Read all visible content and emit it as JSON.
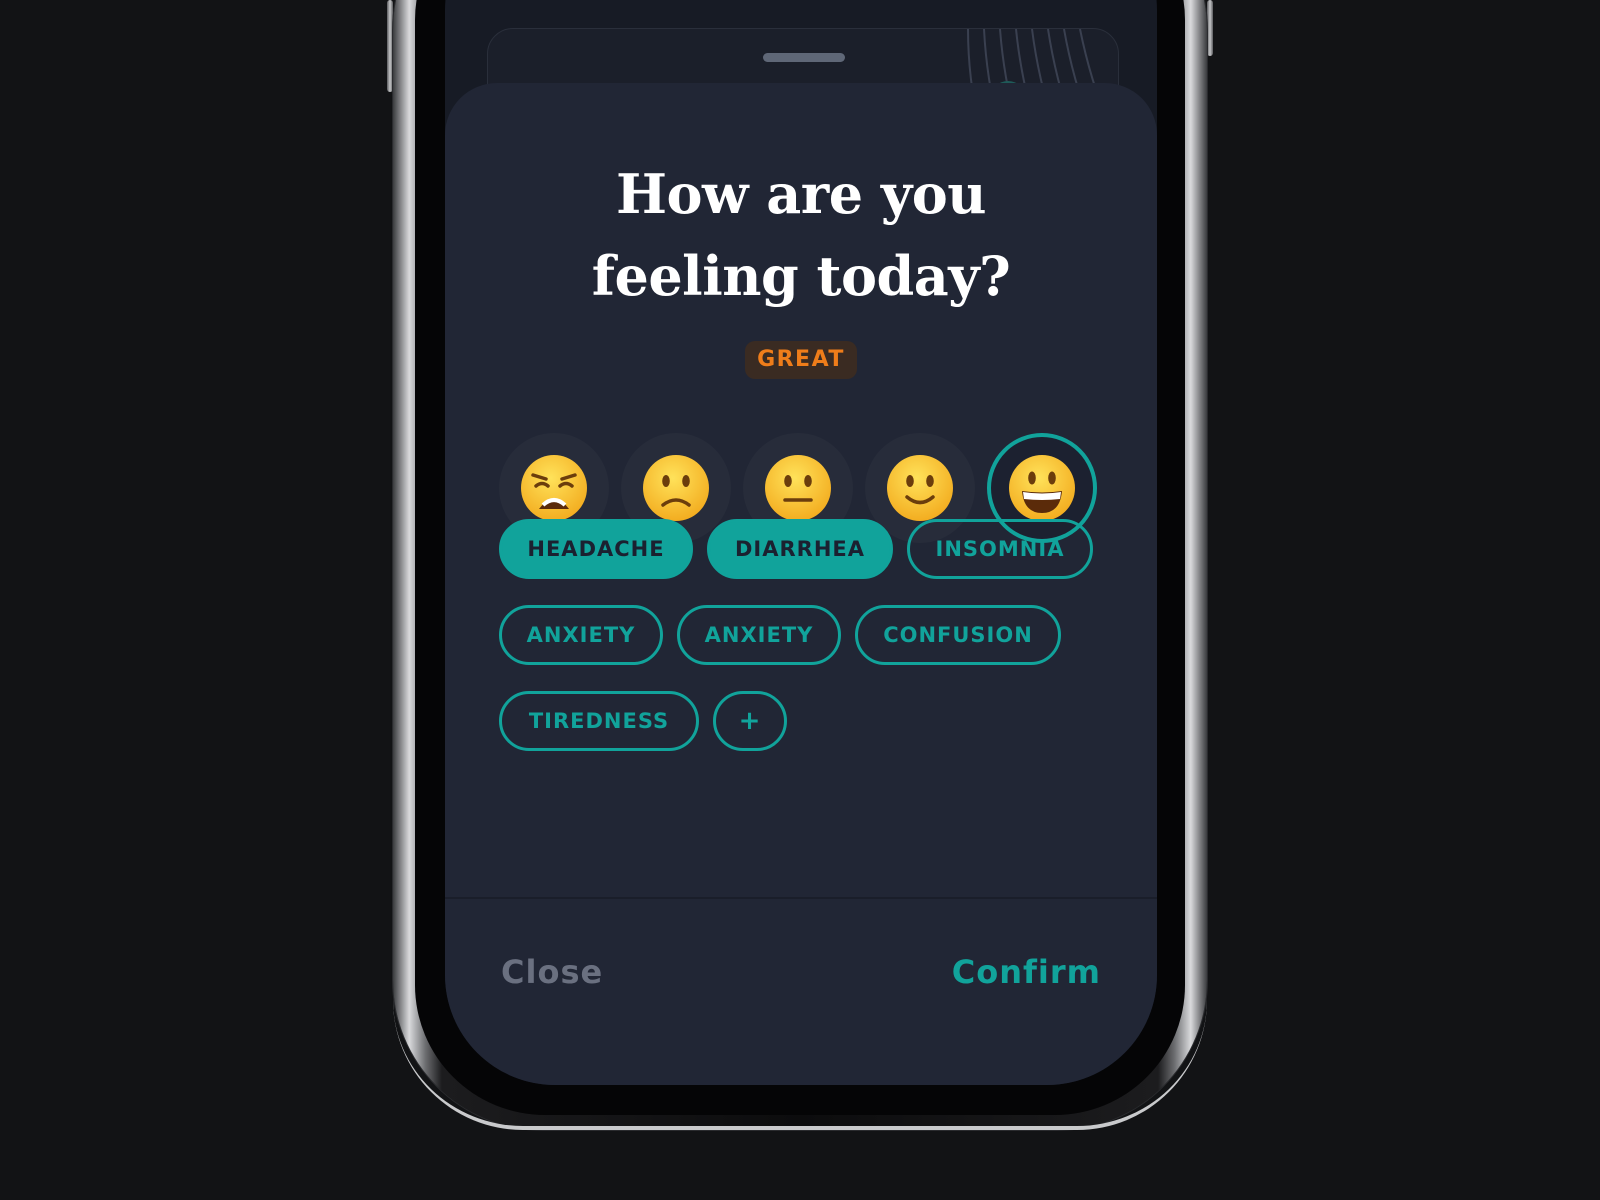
{
  "sheet": {
    "title_line1": "How are you",
    "title_line2": "feeling today?",
    "mood_label": "GREAT",
    "moods": [
      {
        "icon": "weary-face-icon",
        "selected": false
      },
      {
        "icon": "slightly-frowning-face-icon",
        "selected": false
      },
      {
        "icon": "neutral-face-icon",
        "selected": false
      },
      {
        "icon": "slightly-smiling-face-icon",
        "selected": false
      },
      {
        "icon": "grinning-face-icon",
        "selected": true
      }
    ],
    "tags": [
      {
        "label": "HEADACHE",
        "active": true
      },
      {
        "label": "DIARRHEA",
        "active": true
      },
      {
        "label": "INSOMNIA",
        "active": false
      },
      {
        "label": "ANXIETY",
        "active": false
      },
      {
        "label": "ANXIETY",
        "active": false
      },
      {
        "label": "CONFUSION",
        "active": false
      },
      {
        "label": "TIREDNESS",
        "active": false
      }
    ],
    "add_tag_label": "+",
    "close_label": "Close",
    "confirm_label": "Confirm"
  },
  "colors": {
    "accent": "#11a39b",
    "mood_badge_text": "#ef7d1a",
    "sheet_background": "#212635",
    "muted_text": "#6a7080"
  }
}
